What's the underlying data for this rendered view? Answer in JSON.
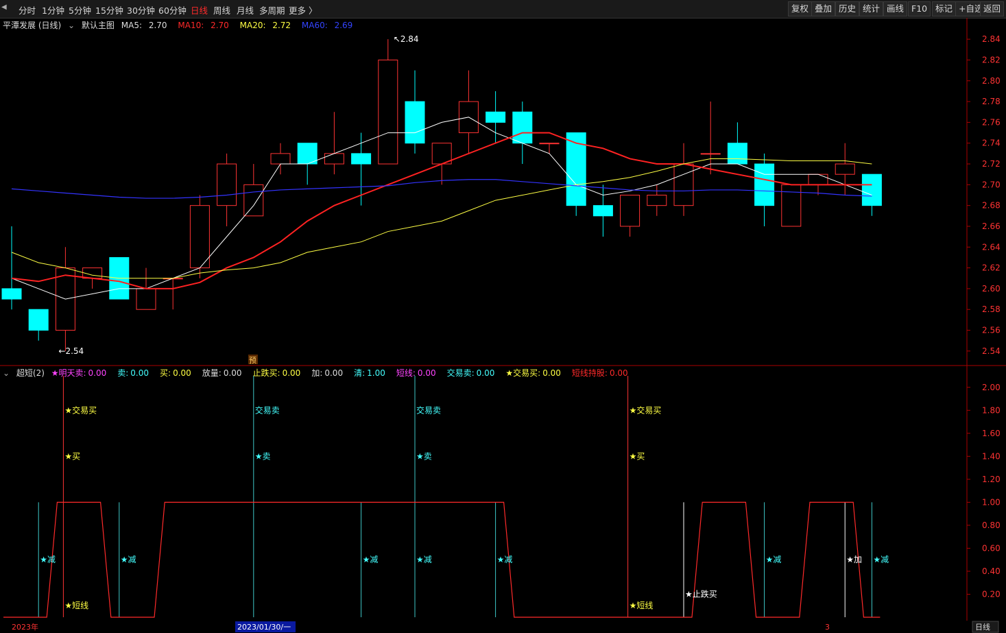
{
  "toolbar": {
    "periods": [
      "分时",
      "1分钟",
      "5分钟",
      "15分钟",
      "30分钟",
      "60分钟",
      "日线",
      "周线",
      "月线",
      "多周期",
      "更多 〉"
    ],
    "active_period": "日线",
    "right_buttons": [
      "复权",
      "叠加",
      "历史",
      "统计",
      "画线",
      "F10",
      "标记",
      "+自选",
      "返回"
    ]
  },
  "main_legend": {
    "stock": "平潭发展 (日线)",
    "template": "默认主图",
    "ma5_label": "MA5:",
    "ma5_value": "2.70",
    "ma10_label": "MA10:",
    "ma10_value": "2.70",
    "ma20_label": "MA20:",
    "ma20_value": "2.72",
    "ma60_label": "MA60:",
    "ma60_value": "2.69"
  },
  "annotations": {
    "high": "2.84",
    "low": "2.54",
    "pre": "预"
  },
  "sub_legend": {
    "name": "超短(2)",
    "items": [
      {
        "label": "★明天卖:",
        "value": "0.00",
        "color": "#ff44ff"
      },
      {
        "label": "卖:",
        "value": "0.00",
        "color": "#44ffff"
      },
      {
        "label": "买:",
        "value": "0.00",
        "color": "#ffff44"
      },
      {
        "label": "放量:",
        "value": "0.00",
        "color": "#dddddd"
      },
      {
        "label": "止跌买:",
        "value": "0.00",
        "color": "#ffff44"
      },
      {
        "label": "加:",
        "value": "0.00",
        "color": "#dddddd"
      },
      {
        "label": "清:",
        "value": "1.00",
        "color": "#44ffff"
      },
      {
        "label": "短线:",
        "value": "0.00",
        "color": "#ff44ff"
      },
      {
        "label": "交易卖:",
        "value": "0.00",
        "color": "#44ffff"
      },
      {
        "label": "★交易买:",
        "value": "0.00",
        "color": "#ffff44"
      },
      {
        "label": "短线持股:",
        "value": "0.00",
        "color": "#ff2a2a"
      }
    ]
  },
  "bottom": {
    "year": "2023年",
    "date_cursor": "2023/01/30/一",
    "month_mark": "3",
    "period_btn": "日线"
  },
  "colors": {
    "up": "#ff3333",
    "down": "#00ffff",
    "ma5": "#ffffff",
    "ma10": "#ff2222",
    "ma20": "#ffff44",
    "ma60": "#3333ff",
    "axis": "#aa0000",
    "grid": "#550000"
  },
  "chart_data": [
    {
      "type": "candlestick",
      "title": "平潭发展 (日线)",
      "ylim": [
        2.53,
        2.85
      ],
      "y_ticks": [
        2.54,
        2.56,
        2.58,
        2.6,
        2.62,
        2.64,
        2.66,
        2.68,
        2.7,
        2.72,
        2.74,
        2.76,
        2.78,
        2.8,
        2.82,
        2.84
      ],
      "candles": [
        {
          "o": 2.6,
          "h": 2.66,
          "l": 2.58,
          "c": 2.59
        },
        {
          "o": 2.58,
          "h": 2.58,
          "l": 2.55,
          "c": 2.56
        },
        {
          "o": 2.56,
          "h": 2.64,
          "l": 2.54,
          "c": 2.62
        },
        {
          "o": 2.61,
          "h": 2.62,
          "l": 2.6,
          "c": 2.62
        },
        {
          "o": 2.63,
          "h": 2.63,
          "l": 2.59,
          "c": 2.59
        },
        {
          "o": 2.58,
          "h": 2.62,
          "l": 2.58,
          "c": 2.6
        },
        {
          "o": 2.61,
          "h": 2.61,
          "l": 2.58,
          "c": 2.61
        },
        {
          "o": 2.62,
          "h": 2.69,
          "l": 2.61,
          "c": 2.68
        },
        {
          "o": 2.68,
          "h": 2.73,
          "l": 2.66,
          "c": 2.72
        },
        {
          "o": 2.67,
          "h": 2.72,
          "l": 2.67,
          "c": 2.7
        },
        {
          "o": 2.72,
          "h": 2.74,
          "l": 2.71,
          "c": 2.73
        },
        {
          "o": 2.74,
          "h": 2.74,
          "l": 2.7,
          "c": 2.72
        },
        {
          "o": 2.72,
          "h": 2.77,
          "l": 2.71,
          "c": 2.73
        },
        {
          "o": 2.73,
          "h": 2.75,
          "l": 2.68,
          "c": 2.72
        },
        {
          "o": 2.72,
          "h": 2.84,
          "l": 2.72,
          "c": 2.82
        },
        {
          "o": 2.78,
          "h": 2.81,
          "l": 2.73,
          "c": 2.74
        },
        {
          "o": 2.72,
          "h": 2.74,
          "l": 2.7,
          "c": 2.74
        },
        {
          "o": 2.75,
          "h": 2.81,
          "l": 2.73,
          "c": 2.78
        },
        {
          "o": 2.77,
          "h": 2.79,
          "l": 2.74,
          "c": 2.76
        },
        {
          "o": 2.77,
          "h": 2.78,
          "l": 2.72,
          "c": 2.74
        },
        {
          "o": 2.74,
          "h": 2.74,
          "l": 2.73,
          "c": 2.74
        },
        {
          "o": 2.75,
          "h": 2.75,
          "l": 2.67,
          "c": 2.68
        },
        {
          "o": 2.68,
          "h": 2.7,
          "l": 2.65,
          "c": 2.67
        },
        {
          "o": 2.66,
          "h": 2.69,
          "l": 2.65,
          "c": 2.69
        },
        {
          "o": 2.68,
          "h": 2.7,
          "l": 2.67,
          "c": 2.69
        },
        {
          "o": 2.68,
          "h": 2.74,
          "l": 2.67,
          "c": 2.72
        },
        {
          "o": 2.73,
          "h": 2.78,
          "l": 2.71,
          "c": 2.73
        },
        {
          "o": 2.74,
          "h": 2.76,
          "l": 2.72,
          "c": 2.72
        },
        {
          "o": 2.72,
          "h": 2.73,
          "l": 2.66,
          "c": 2.68
        },
        {
          "o": 2.66,
          "h": 2.7,
          "l": 2.66,
          "c": 2.7
        },
        {
          "o": 2.7,
          "h": 2.71,
          "l": 2.69,
          "c": 2.71
        },
        {
          "o": 2.71,
          "h": 2.74,
          "l": 2.69,
          "c": 2.72
        },
        {
          "o": 2.71,
          "h": 2.71,
          "l": 2.67,
          "c": 2.68
        }
      ],
      "series": [
        {
          "name": "MA5",
          "values": [
            2.61,
            2.6,
            2.59,
            2.595,
            2.6,
            2.6,
            2.61,
            2.62,
            2.65,
            2.68,
            2.72,
            2.72,
            2.73,
            2.74,
            2.75,
            2.75,
            2.76,
            2.765,
            2.75,
            2.74,
            2.73,
            2.7,
            2.69,
            2.694,
            2.7,
            2.71,
            2.72,
            2.72,
            2.71,
            2.71,
            2.71,
            2.7,
            2.69
          ]
        },
        {
          "name": "MA10",
          "values": [
            2.61,
            2.607,
            2.613,
            2.61,
            2.607,
            2.6,
            2.6,
            2.606,
            2.62,
            2.63,
            2.645,
            2.665,
            2.68,
            2.69,
            2.7,
            2.71,
            2.72,
            2.73,
            2.74,
            2.75,
            2.75,
            2.74,
            2.735,
            2.725,
            2.72,
            2.72,
            2.715,
            2.71,
            2.705,
            2.7,
            2.7,
            2.7,
            2.7
          ]
        },
        {
          "name": "MA20",
          "values": [
            2.635,
            2.625,
            2.62,
            2.613,
            2.61,
            2.61,
            2.61,
            2.615,
            2.618,
            2.62,
            2.625,
            2.635,
            2.64,
            2.645,
            2.655,
            2.66,
            2.665,
            2.675,
            2.685,
            2.69,
            2.695,
            2.7,
            2.703,
            2.707,
            2.713,
            2.72,
            2.725,
            2.725,
            2.724,
            2.723,
            2.723,
            2.723,
            2.72
          ]
        },
        {
          "name": "MA60",
          "values": [
            2.696,
            2.694,
            2.692,
            2.69,
            2.688,
            2.687,
            2.687,
            2.688,
            2.69,
            2.693,
            2.695,
            2.696,
            2.697,
            2.698,
            2.699,
            2.702,
            2.704,
            2.705,
            2.705,
            2.703,
            2.701,
            2.699,
            2.697,
            2.695,
            2.694,
            2.694,
            2.695,
            2.695,
            2.694,
            2.693,
            2.692,
            2.69,
            2.689
          ]
        }
      ]
    },
    {
      "type": "line",
      "title": "超短(2)",
      "ylim": [
        0,
        2.1
      ],
      "y_ticks": [
        0.2,
        0.4,
        0.6,
        0.8,
        1.0,
        1.2,
        1.4,
        1.6,
        1.8,
        2.0
      ],
      "series": [
        {
          "name": "短线持股",
          "values": [
            0,
            0,
            1,
            1,
            0,
            0,
            1,
            1,
            1,
            1,
            1,
            1,
            1,
            1,
            1,
            1,
            1,
            1,
            1,
            0,
            0,
            0,
            0,
            0,
            0,
            0,
            1,
            1,
            0,
            0,
            1,
            1,
            0
          ]
        }
      ],
      "markers": [
        {
          "i": 1,
          "text": "★减",
          "color": "#44ffff",
          "level": 0.5
        },
        {
          "i": 2,
          "text": "★交易买",
          "color": "#ffff44",
          "level": 1.8
        },
        {
          "i": 2,
          "text": "★买",
          "color": "#ffff44",
          "level": 1.4
        },
        {
          "i": 2,
          "text": "★短线",
          "color": "#ffff44",
          "level": 0.1
        },
        {
          "i": 4,
          "text": "★减",
          "color": "#44ffff",
          "level": 0.5
        },
        {
          "i": 9,
          "text": "交易卖",
          "color": "#44ffff",
          "level": 1.8
        },
        {
          "i": 9,
          "text": "★卖",
          "color": "#44ffff",
          "level": 1.4
        },
        {
          "i": 13,
          "text": "★减",
          "color": "#44ffff",
          "level": 0.5
        },
        {
          "i": 15,
          "text": "交易卖",
          "color": "#44ffff",
          "level": 1.8
        },
        {
          "i": 15,
          "text": "★卖",
          "color": "#44ffff",
          "level": 1.4
        },
        {
          "i": 15,
          "text": "★减",
          "color": "#44ffff",
          "level": 0.5
        },
        {
          "i": 18,
          "text": "★减",
          "color": "#44ffff",
          "level": 0.5
        },
        {
          "i": 23,
          "text": "★交易买",
          "color": "#ffff44",
          "level": 1.8
        },
        {
          "i": 23,
          "text": "★买",
          "color": "#ffff44",
          "level": 1.4
        },
        {
          "i": 23,
          "text": "★短线",
          "color": "#ffff44",
          "level": 0.1
        },
        {
          "i": 25,
          "text": "★止跌买",
          "color": "#ffffff",
          "level": 0.2
        },
        {
          "i": 28,
          "text": "★减",
          "color": "#44ffff",
          "level": 0.5
        },
        {
          "i": 31,
          "text": "★加",
          "color": "#ffffff",
          "level": 0.5
        },
        {
          "i": 32,
          "text": "★减",
          "color": "#44ffff",
          "level": 0.5
        }
      ]
    }
  ]
}
